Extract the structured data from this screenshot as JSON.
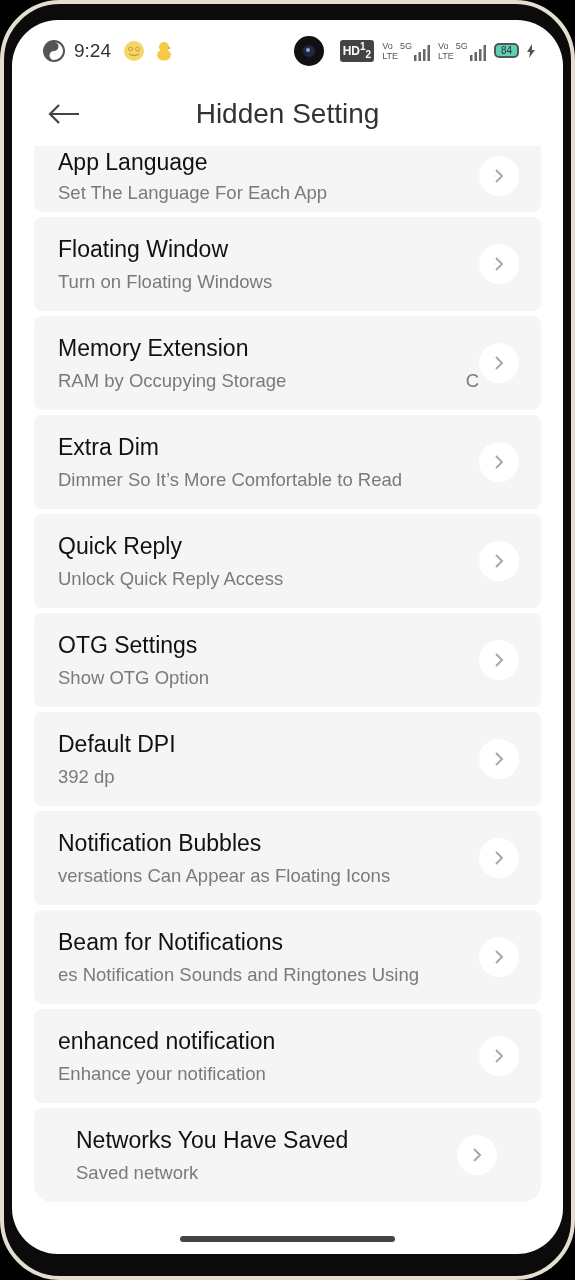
{
  "status_bar": {
    "time": "9:24",
    "hd_badge": "HD$^{1}$$_{2}$",
    "sims": [
      {
        "volte": "Vo",
        "lte": "LTE",
        "network": "5G"
      },
      {
        "volte": "Vo",
        "lte": "LTE",
        "network": "5G"
      }
    ],
    "battery": "84",
    "charging": true
  },
  "header": {
    "title": "Hidden Setting"
  },
  "settings": [
    {
      "title": "App Language",
      "subtitle": "Set The Language For Each App",
      "inset": false
    },
    {
      "title": "Floating Window",
      "subtitle": "Turn on Floating Windows",
      "inset": false
    },
    {
      "title": "Memory Extension",
      "subtitle": "RAM by Occupying Storage",
      "marquee_tail": "C",
      "inset": false
    },
    {
      "title": "Extra Dim",
      "subtitle": "Dimmer So It’s More Comfortable to Read",
      "inset": false
    },
    {
      "title": "Quick Reply",
      "subtitle": "Unlock Quick Reply Access",
      "inset": false
    },
    {
      "title": "OTG Settings",
      "subtitle": "Show OTG Option",
      "inset": false
    },
    {
      "title": "Default DPI",
      "subtitle": "392 dp",
      "inset": false
    },
    {
      "title": "Notification Bubbles",
      "subtitle": "versations Can Appear as Floating Icons",
      "inset": false
    },
    {
      "title": "Beam for Notifications",
      "subtitle": "es Notification Sounds and Ringtones Using",
      "inset": false
    },
    {
      "title": "enhanced notification",
      "subtitle": "Enhance your notification",
      "inset": false
    },
    {
      "title": "Networks You Have Saved",
      "subtitle": "Saved network",
      "inset": true
    }
  ]
}
